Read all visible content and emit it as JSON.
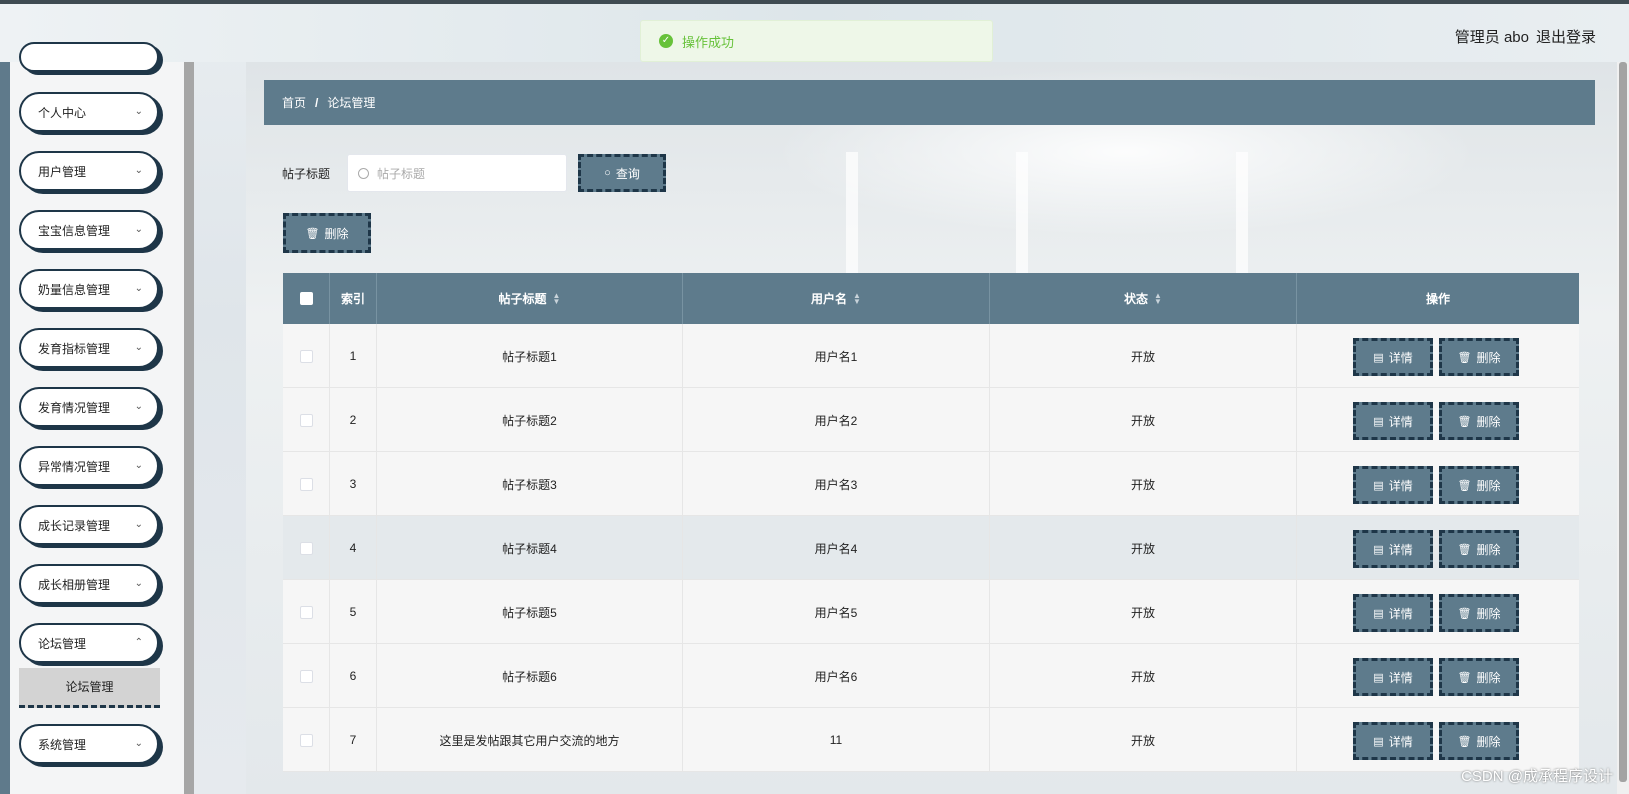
{
  "header": {
    "user_label": "管理员 abo",
    "logout_label": "退出登录"
  },
  "toast": {
    "message": "操作成功"
  },
  "sidebar": {
    "items": [
      {
        "label": "个人中心"
      },
      {
        "label": "用户管理"
      },
      {
        "label": "宝宝信息管理"
      },
      {
        "label": "奶量信息管理"
      },
      {
        "label": "发育指标管理"
      },
      {
        "label": "发育情况管理"
      },
      {
        "label": "异常情况管理"
      },
      {
        "label": "成长记录管理"
      },
      {
        "label": "成长相册管理"
      },
      {
        "label": "论坛管理"
      },
      {
        "label": "系统管理"
      }
    ],
    "active_sub": "论坛管理"
  },
  "breadcrumb": {
    "home": "首页",
    "current": "论坛管理"
  },
  "search": {
    "label": "帖子标题",
    "placeholder": "帖子标题",
    "button": "查询"
  },
  "toolbar": {
    "delete_label": "删除"
  },
  "table": {
    "headers": {
      "index": "索引",
      "title": "帖子标题",
      "username": "用户名",
      "status": "状态",
      "actions": "操作"
    },
    "detail_label": "详情",
    "delete_label": "删除",
    "rows": [
      {
        "index": "1",
        "title": "帖子标题1",
        "username": "用户名1",
        "status": "开放"
      },
      {
        "index": "2",
        "title": "帖子标题2",
        "username": "用户名2",
        "status": "开放"
      },
      {
        "index": "3",
        "title": "帖子标题3",
        "username": "用户名3",
        "status": "开放"
      },
      {
        "index": "4",
        "title": "帖子标题4",
        "username": "用户名4",
        "status": "开放"
      },
      {
        "index": "5",
        "title": "帖子标题5",
        "username": "用户名5",
        "status": "开放"
      },
      {
        "index": "6",
        "title": "帖子标题6",
        "username": "用户名6",
        "status": "开放"
      },
      {
        "index": "7",
        "title": "这里是发帖跟其它用户交流的地方",
        "username": "11",
        "status": "开放"
      }
    ]
  },
  "watermark": "CSDN @成承程序设计",
  "colors": {
    "primary": "#5e7b8c",
    "dark_border": "#1e3648",
    "success": "#67c23a"
  }
}
